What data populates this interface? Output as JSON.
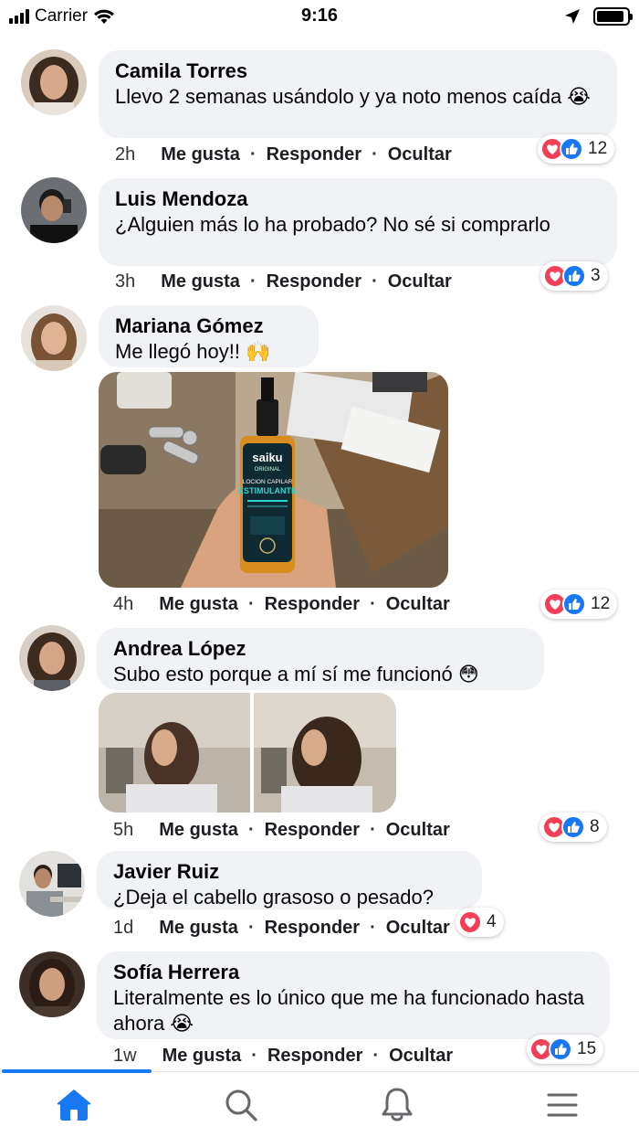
{
  "status_bar": {
    "carrier": "Carrier",
    "time": "9:16",
    "icons": [
      "signal-icon",
      "wifi-icon",
      "location-arrow-icon",
      "battery-icon"
    ],
    "battery_level": 0.9
  },
  "comments": [
    {
      "name": "Camila Torres",
      "text": "Llevo 2 semanas usándolo y ya noto menos caída 😭",
      "time": "2h",
      "like": "Me gusta",
      "reply": "Responder",
      "hide": "Ocultar",
      "reactions": [
        "love",
        "like"
      ],
      "count": "12"
    },
    {
      "name": "Luis Mendoza",
      "text": "¿Alguien más lo ha probado? No sé si comprarlo",
      "time": "3h",
      "like": "Me gusta",
      "reply": "Responder",
      "hide": "Ocultar",
      "reactions": [
        "love",
        "like"
      ],
      "count": "3"
    },
    {
      "name": "Mariana Gómez",
      "text": "Me llegó hoy!! 🙌",
      "time": "4h",
      "like": "Me gusta",
      "reply": "Responder",
      "hide": "Ocultar",
      "reactions": [
        "love",
        "like"
      ],
      "count": "12",
      "product": {
        "brand": "saiku",
        "brand_sub": "ORIGINAL",
        "line1": "LOCION CAPILAR",
        "line2": "ESTIMULANTE"
      }
    },
    {
      "name": "Andrea López",
      "text": "Subo esto porque a mí sí me funcionó 😳",
      "time": "5h",
      "like": "Me gusta",
      "reply": "Responder",
      "hide": "Ocultar",
      "reactions": [
        "love",
        "like"
      ],
      "count": "8"
    },
    {
      "name": "Javier Ruiz",
      "text": "¿Deja el cabello grasoso o pesado?",
      "time": "1d",
      "like": "Me gusta",
      "reply": "Responder",
      "hide": "Ocultar",
      "reactions": [
        "love"
      ],
      "count": "4"
    },
    {
      "name": "Sofía Herrera",
      "text": "Literalmente es lo único que me ha funcionado hasta ahora 😭",
      "time": "1w",
      "like": "Me gusta",
      "reply": "Responder",
      "hide": "Ocultar",
      "reactions": [
        "love",
        "like"
      ],
      "count": "15"
    }
  ],
  "tabbar": {
    "tabs": [
      "home-icon",
      "search-icon",
      "bell-icon",
      "menu-icon"
    ],
    "active": "home-icon",
    "accent": "#1877f2"
  },
  "colors": {
    "bubble": "#f0f2f5",
    "love": "#f33e58",
    "like": "#1877f2"
  }
}
